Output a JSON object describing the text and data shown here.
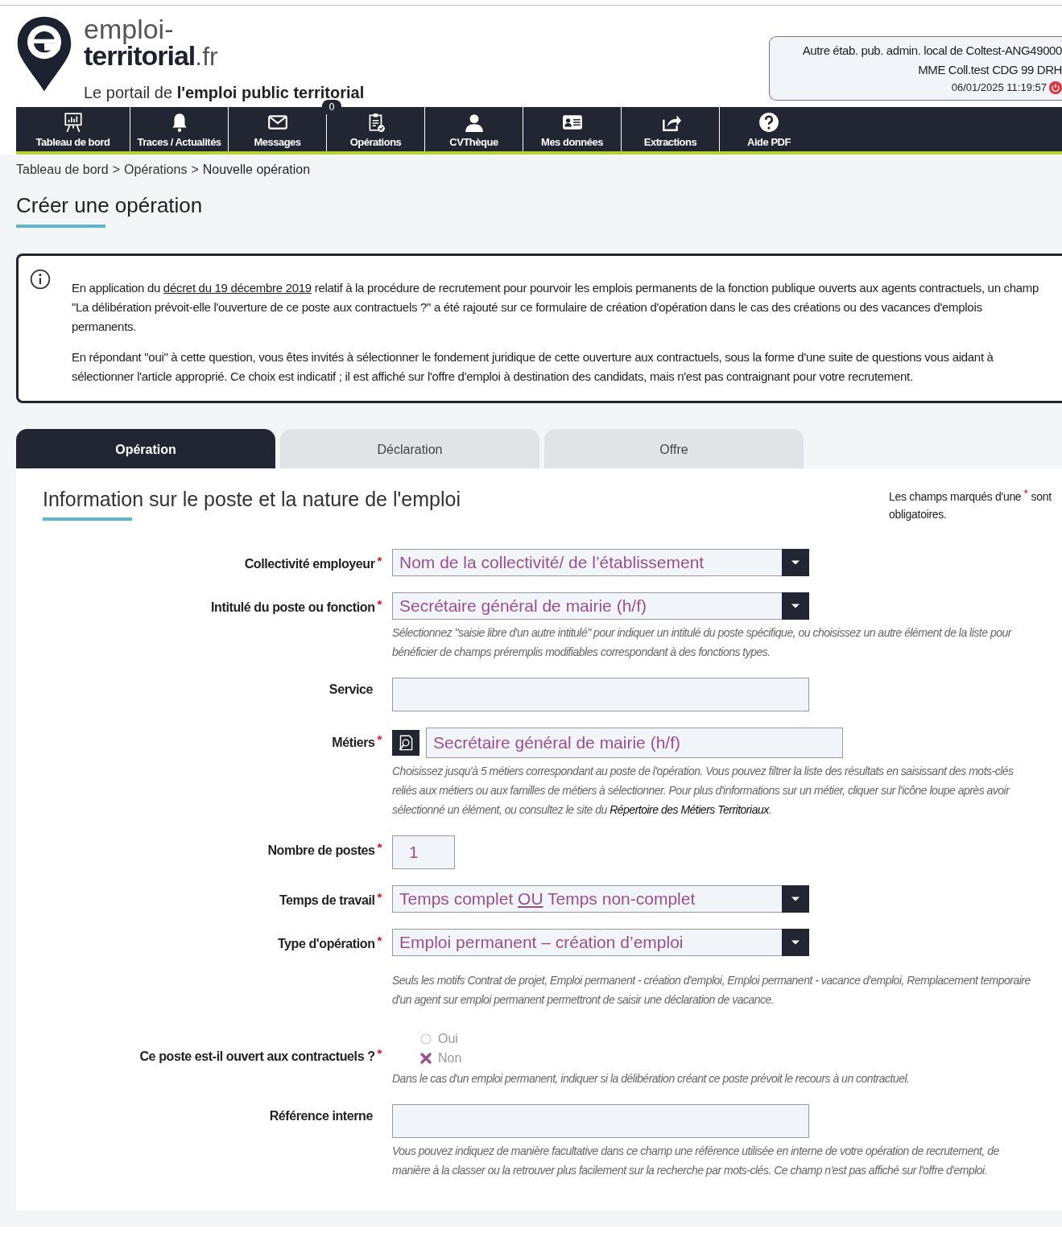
{
  "logo": {
    "line1": "emploi-",
    "line2": "territorial",
    "suffix": ".fr",
    "tagline": "Le portail de **l'emploi public territorial**"
  },
  "user_box": {
    "lines": [
      "Autre étab. pub. admin. local de Coltest-ANG49000",
      "MME Coll.test CDG 99 DRH"
    ],
    "datetime": "06/01/2025 11:19:57"
  },
  "nav": [
    {
      "label": "Tableau de bord"
    },
    {
      "label": "Traces / Actualités"
    },
    {
      "label": "Messages",
      "badge": "0"
    },
    {
      "label": "Opérations"
    },
    {
      "label": "CVThèque"
    },
    {
      "label": "Mes données"
    },
    {
      "label": "Extractions"
    },
    {
      "label": "Aide PDF"
    }
  ],
  "breadcrumb": {
    "items": [
      "Tableau de bord",
      "Opérations",
      "Nouvelle opération"
    ],
    "separator": ">"
  },
  "page_title": "Créer une opération",
  "notice": {
    "paragraphs": [
      {
        "before": "En application du ",
        "link": "décret du 19 décembre 2019",
        "after": " relatif à la procédure de recrutement pour pourvoir les emplois permanents de la fonction publique ouverts aux agents contractuels, un champ \"La délibération prévoit-elle l'ouverture de ce poste aux contractuels ?\" a été rajouté sur ce formulaire de création d'opération dans le cas des créations ou des vacances d'emplois permanents."
      },
      {
        "before": "En répondant \"oui\" à cette question, vous êtes invités à sélectionner le fondement juridique de cette ouverture aux contractuels, sous la forme d'une suite de questions vous aidant à sélectionner l'article approprié. Ce choix est indicatif ; il est affiché sur l'offre d'emploi à destination des candidats, mais n'est pas contraignant pour votre recrutement."
      }
    ]
  },
  "tabs": [
    {
      "label": "Opération",
      "selected": true
    },
    {
      "label": "Déclaration",
      "selected": false
    },
    {
      "label": "Offre",
      "selected": false
    }
  ],
  "section_title": "Information sur le poste et la nature de l'emploi",
  "required_note": {
    "before": "Les champs marqués d'une",
    "mark": "*",
    "after": "sont obligatoires."
  },
  "fields": [
    {
      "kind": "select",
      "label": "Collectivité employeur",
      "required": true,
      "value": "Nom de la collectivité/ de l’établissement"
    },
    {
      "kind": "select",
      "label": "Intitulé du poste ou fonction",
      "required": true,
      "value": "Secrétaire général de mairie (h/f)",
      "hint": "Sélectionnez \"saisie libre d'un autre intitulé\" pour indiquer un intitulé du poste spécifique, ou choisissez un autre élément de la liste pour bénéficier de champs préremplis modifiables correspondant à des fonctions types."
    },
    {
      "kind": "text",
      "label": "Service",
      "required": false
    },
    {
      "kind": "search",
      "label": "Métiers",
      "required": true,
      "value": "Secrétaire général de mairie (h/f)",
      "hint": "Choisissez jusqu'à 5 métiers correspondant au poste de l'opération. Vous pouvez filtrer la liste des résultats en saisissant des mots-clés reliés aux métiers ou aux familles de métiers à sélectionner. Pour plus d'informations sur un métier, cliquer sur l'icône loupe après avoir sélectionné un élément, ou consultez le site du ",
      "hint_link": "Répertoire des Métiers Territoriaux",
      "hint_after": "."
    },
    {
      "kind": "number",
      "label": "Nombre de postes",
      "required": true,
      "value": "1"
    },
    {
      "kind": "select",
      "label": "Temps de travail",
      "required": true,
      "value_parts": [
        {
          "text": "Temps complet ",
          "underlined": false
        },
        {
          "text": "OU",
          "underlined": true
        },
        {
          "text": " Temps non-complet",
          "underlined": false
        }
      ]
    },
    {
      "kind": "select",
      "label": "Type d'opération",
      "required": true,
      "value": "Emploi permanent – création d’emploi",
      "hint": "Seuls les motifs Contrat de projet, Emploi permanent - création d'emploi, Emploi permanent - vacance d'emploi, Remplacement temporaire d'un agent sur emploi permanent permettront de saisir une déclaration de vacance."
    },
    {
      "kind": "radio",
      "label": "Ce poste est-il ouvert aux contractuels ?",
      "required": true,
      "options": [
        {
          "label": "Oui",
          "selected": false
        },
        {
          "label": "Non",
          "selected": true
        }
      ],
      "hint": "Dans le cas d'un emploi permanent, indiquer si la délibération créant ce poste prévoit le recours à un contractuel."
    },
    {
      "kind": "text",
      "label": "Référence interne",
      "required": false,
      "hint": "Vous pouvez indiquez de manière facultative dans ce champ une référence utilisée en interne de votre opération de recrutement, de manière à la classer ou la retrouver plus facilement sur la recherche par mots-clés. Ce champ n'est pas affiché sur l'offre d'emploi."
    }
  ]
}
